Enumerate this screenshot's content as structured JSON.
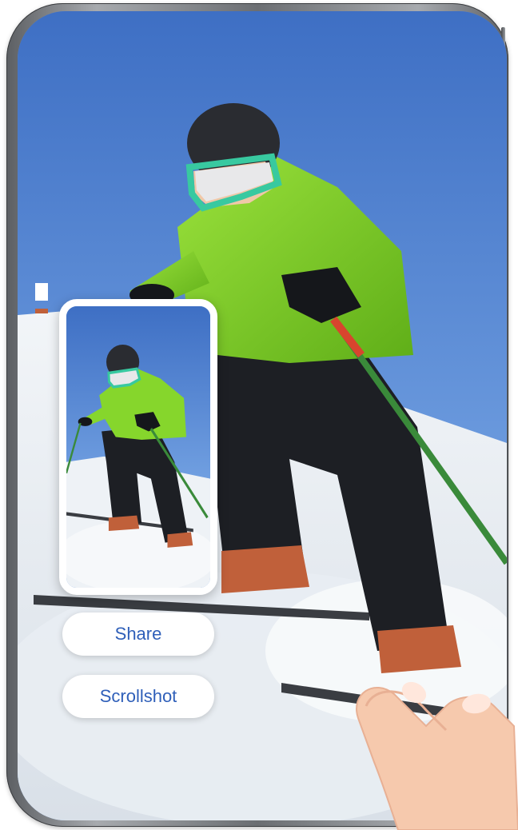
{
  "screenshot_preview": {
    "actions": {
      "share_label": "Share",
      "scrollshot_label": "Scrollshot"
    }
  },
  "colors": {
    "action_text": "#2f5fb9",
    "sky": "#5f8fd8",
    "jacket": "#7ed321"
  },
  "icons": {
    "gesture": "hand-pointer-icon"
  }
}
